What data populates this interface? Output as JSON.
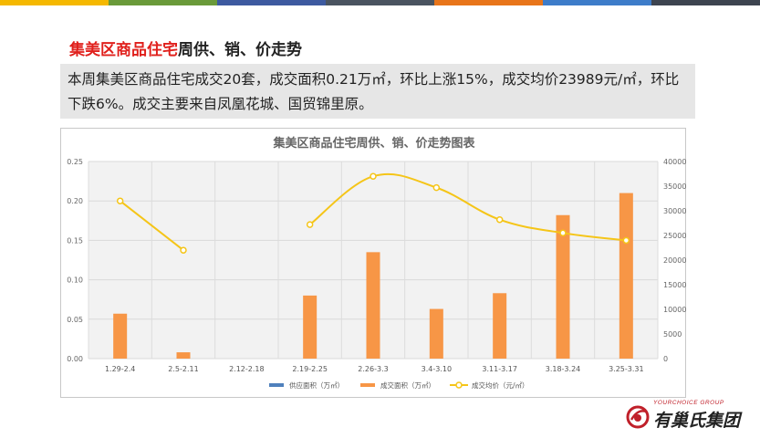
{
  "header": {
    "title_accent": "集美区商品住宅",
    "title_rest": "周供、销、价走势",
    "bar_colors": [
      "#f5b800",
      "#6a9a3a",
      "#3d5aa0",
      "#4a5460",
      "#e8751a",
      "#3d7cc9",
      "#3d4450"
    ]
  },
  "summary": {
    "text": "本周集美区商品住宅成交20套，成交面积0.21万㎡，环比上涨15%，成交均价23989元/㎡，环比下跌6%。成交主要来自凤凰花城、国贸锦里原。"
  },
  "chart_data": {
    "type": "bar",
    "title": "集美区商品住宅周供、销、价走势图表",
    "categories": [
      "1.29-2.4",
      "2.5-2.11",
      "2.12-2.18",
      "2.19-2.25",
      "2.26-3.3",
      "3.4-3.10",
      "3.11-3.17",
      "3.18-3.24",
      "3.25-3.31"
    ],
    "ylim_left": [
      0,
      0.25
    ],
    "yticks_left": [
      "0.00",
      "0.05",
      "0.10",
      "0.15",
      "0.20",
      "0.25"
    ],
    "ylim_right": [
      0,
      40000
    ],
    "yticks_right": [
      "0",
      "5000",
      "10000",
      "15000",
      "20000",
      "25000",
      "30000",
      "35000",
      "40000"
    ],
    "grid": true,
    "legend_position": "bottom",
    "series": [
      {
        "name": "供应面积（万㎡）",
        "type": "bar",
        "axis": "left",
        "color": "#4f81bd",
        "values": [
          0,
          0,
          0,
          0,
          0,
          0,
          0,
          0,
          0
        ]
      },
      {
        "name": "成交面积（万㎡）",
        "type": "bar",
        "axis": "left",
        "color": "#f79646",
        "values": [
          0.057,
          0.008,
          0,
          0.08,
          0.135,
          0.063,
          0.083,
          0.182,
          0.21
        ]
      },
      {
        "name": "成交均价（元/㎡）",
        "type": "line",
        "axis": "right",
        "color": "#f5c518",
        "values": [
          32000,
          22000,
          null,
          27200,
          37000,
          34700,
          28200,
          25500,
          23989
        ]
      }
    ]
  },
  "logo": {
    "sub": "YOURCHOICE GROUP",
    "main": "有巢氏集团",
    "color": "#c0202a"
  }
}
